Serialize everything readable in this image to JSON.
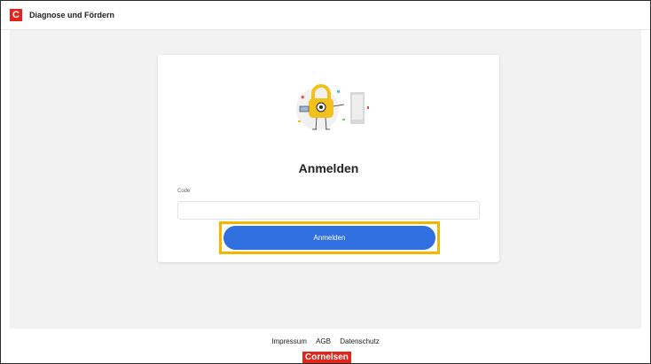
{
  "header": {
    "logo_letter": "C",
    "app_title": "Diagnose und Fördern"
  },
  "login": {
    "heading": "Anmelden",
    "code_label": "Code",
    "code_value": "",
    "code_placeholder": "",
    "submit_label": "Anmelden"
  },
  "footer": {
    "links": [
      "Impressum",
      "AGB",
      "Datenschutz"
    ],
    "brand": "Cornelsen"
  },
  "colors": {
    "brand_red": "#e1251b",
    "button_blue": "#2f6fe0",
    "highlight_yellow": "#f3b500",
    "page_bg": "#f2f2f2"
  },
  "icons": [
    "lock-mascot-illustration"
  ]
}
